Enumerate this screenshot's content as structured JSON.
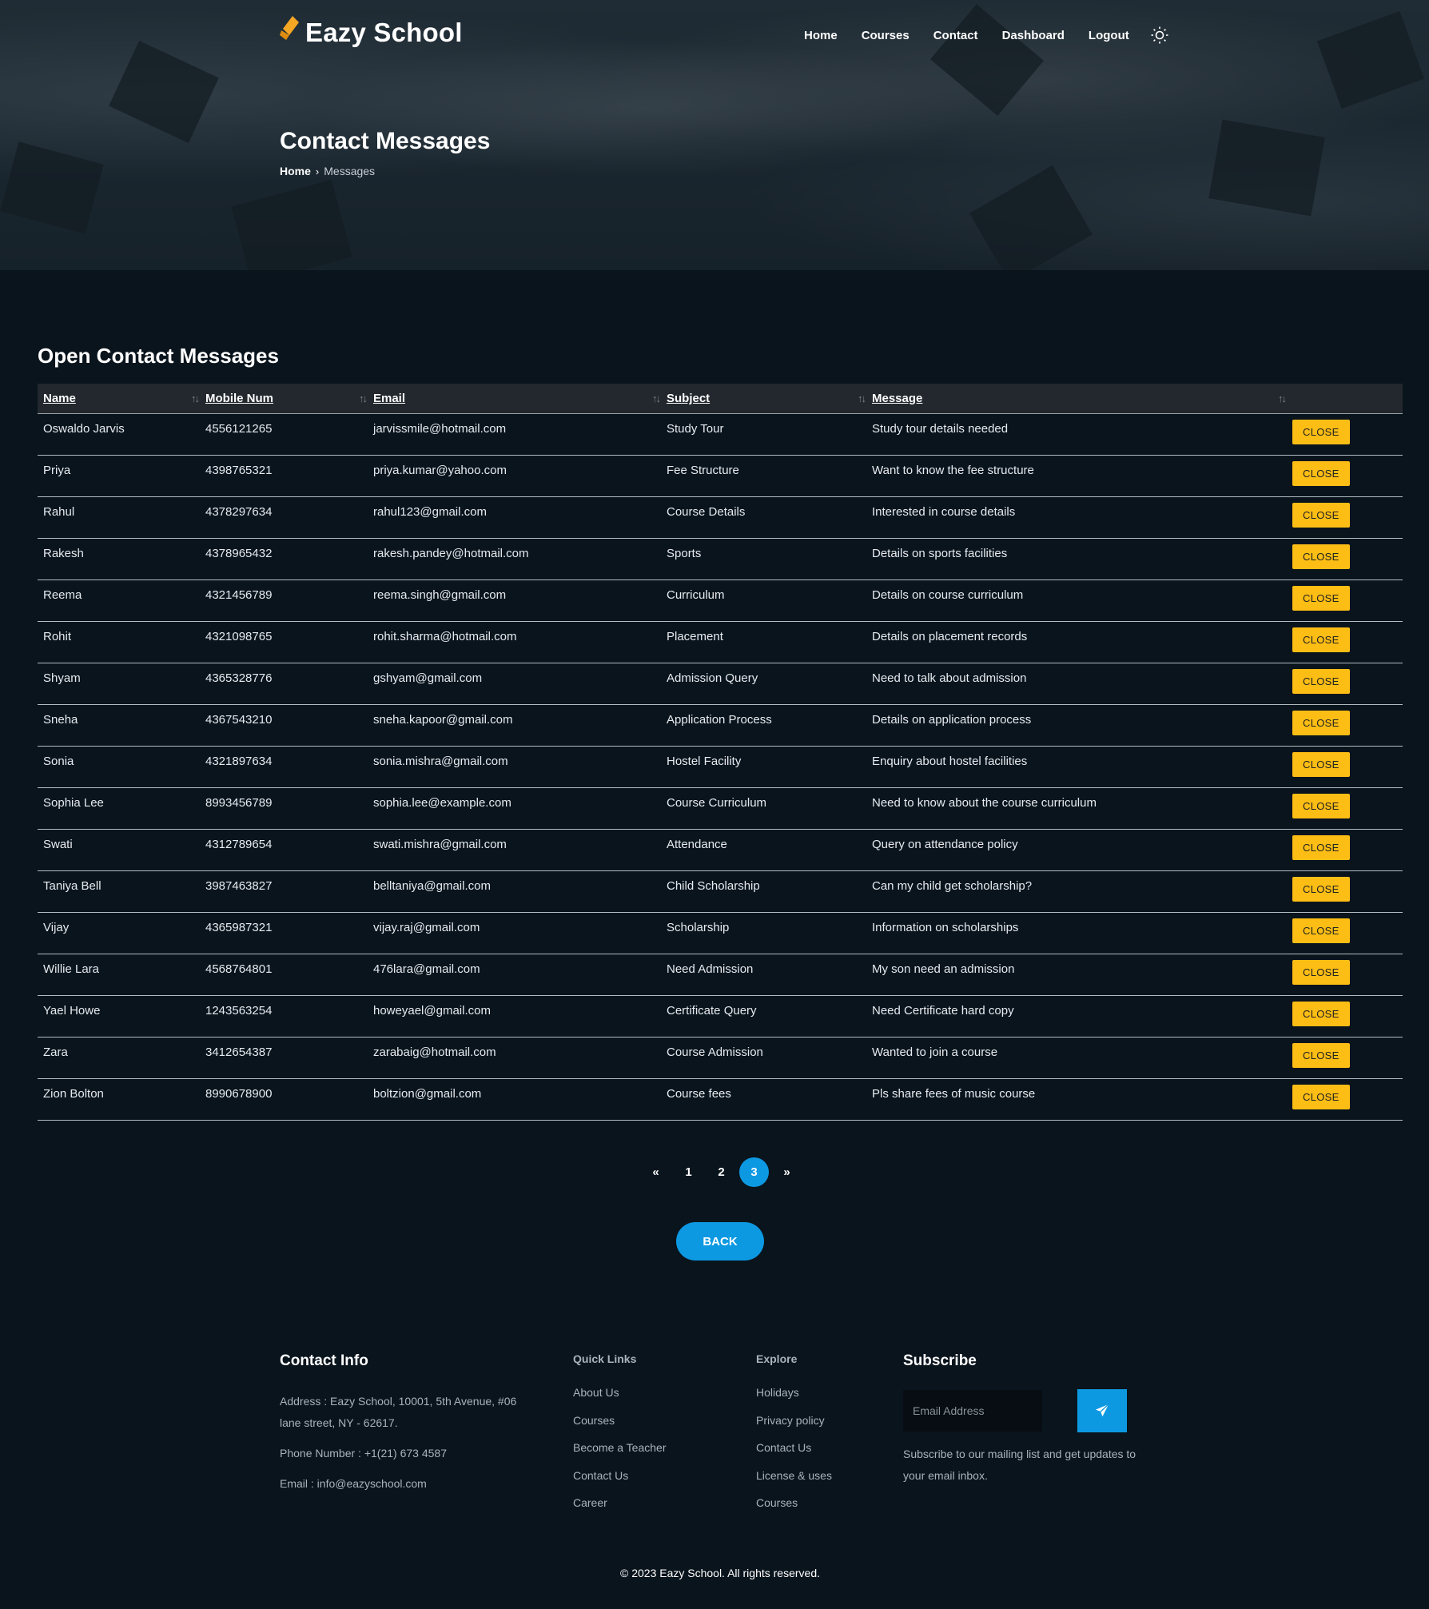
{
  "header": {
    "brand": "Eazy School",
    "nav": [
      "Home",
      "Courses",
      "Contact",
      "Dashboard",
      "Logout"
    ]
  },
  "hero": {
    "title": "Contact Messages",
    "breadcrumb_home": "Home",
    "breadcrumb_current": "Messages"
  },
  "section_title": "Open Contact Messages",
  "table": {
    "columns": [
      "Name",
      "Mobile Num",
      "Email",
      "Subject",
      "Message"
    ],
    "action_label": "CLOSE",
    "rows": [
      [
        "Oswaldo Jarvis",
        "4556121265",
        "jarvissmile@hotmail.com",
        "Study Tour",
        "Study tour details needed"
      ],
      [
        "Priya",
        "4398765321",
        "priya.kumar@yahoo.com",
        "Fee Structure",
        "Want to know the fee structure"
      ],
      [
        "Rahul",
        "4378297634",
        "rahul123@gmail.com",
        "Course Details",
        "Interested in course details"
      ],
      [
        "Rakesh",
        "4378965432",
        "rakesh.pandey@hotmail.com",
        "Sports",
        "Details on sports facilities"
      ],
      [
        "Reema",
        "4321456789",
        "reema.singh@gmail.com",
        "Curriculum",
        "Details on course curriculum"
      ],
      [
        "Rohit",
        "4321098765",
        "rohit.sharma@hotmail.com",
        "Placement",
        "Details on placement records"
      ],
      [
        "Shyam",
        "4365328776",
        "gshyam@gmail.com",
        "Admission Query",
        "Need to talk about admission"
      ],
      [
        "Sneha",
        "4367543210",
        "sneha.kapoor@gmail.com",
        "Application Process",
        "Details on application process"
      ],
      [
        "Sonia",
        "4321897634",
        "sonia.mishra@gmail.com",
        "Hostel Facility",
        "Enquiry about hostel facilities"
      ],
      [
        "Sophia Lee",
        "8993456789",
        "sophia.lee@example.com",
        "Course Curriculum",
        "Need to know about the course curriculum"
      ],
      [
        "Swati",
        "4312789654",
        "swati.mishra@gmail.com",
        "Attendance",
        "Query on attendance policy"
      ],
      [
        "Taniya Bell",
        "3987463827",
        "belltaniya@gmail.com",
        "Child Scholarship",
        "Can my child get scholarship?"
      ],
      [
        "Vijay",
        "4365987321",
        "vijay.raj@gmail.com",
        "Scholarship",
        "Information on scholarships"
      ],
      [
        "Willie Lara",
        "4568764801",
        "476lara@gmail.com",
        "Need Admission",
        "My son need an admission"
      ],
      [
        "Yael Howe",
        "1243563254",
        "howeyael@gmail.com",
        "Certificate Query",
        "Need Certificate hard copy"
      ],
      [
        "Zara",
        "3412654387",
        "zarabaig@hotmail.com",
        "Course Admission",
        "Wanted to join a course"
      ],
      [
        "Zion Bolton",
        "8990678900",
        "boltzion@gmail.com",
        "Course fees",
        "Pls share fees of music course"
      ]
    ]
  },
  "pagination": {
    "prev": "«",
    "pages": [
      "1",
      "2",
      "3"
    ],
    "current": "3",
    "next": "»"
  },
  "back_label": "BACK",
  "footer": {
    "contact_title": "Contact Info",
    "address": "Address : Eazy School, 10001, 5th Avenue, #06 lane street, NY - 62617.",
    "phone": "Phone Number : +1(21) 673 4587",
    "email": "Email : info@eazyschool.com",
    "quick_title": "Quick Links",
    "quick_links": [
      "About Us",
      "Courses",
      "Become a Teacher",
      "Contact Us",
      "Career"
    ],
    "explore_title": "Explore",
    "explore_links": [
      "Holidays",
      "Privacy policy",
      "Contact Us",
      "License & uses",
      "Courses"
    ],
    "subscribe_title": "Subscribe",
    "subscribe_placeholder": "Email Address",
    "subscribe_text": "Subscribe to our mailing list and get updates to your email inbox.",
    "copyright": "© 2023 Eazy School. All rights reserved."
  },
  "colors": {
    "accent": "#0d99e2",
    "close_button": "#fcbd14",
    "logo_icon": "#f5a623",
    "background": "#0a141d"
  },
  "icons": [
    "graduation-cap-icon",
    "sun-icon",
    "sort-icon",
    "send-icon"
  ]
}
